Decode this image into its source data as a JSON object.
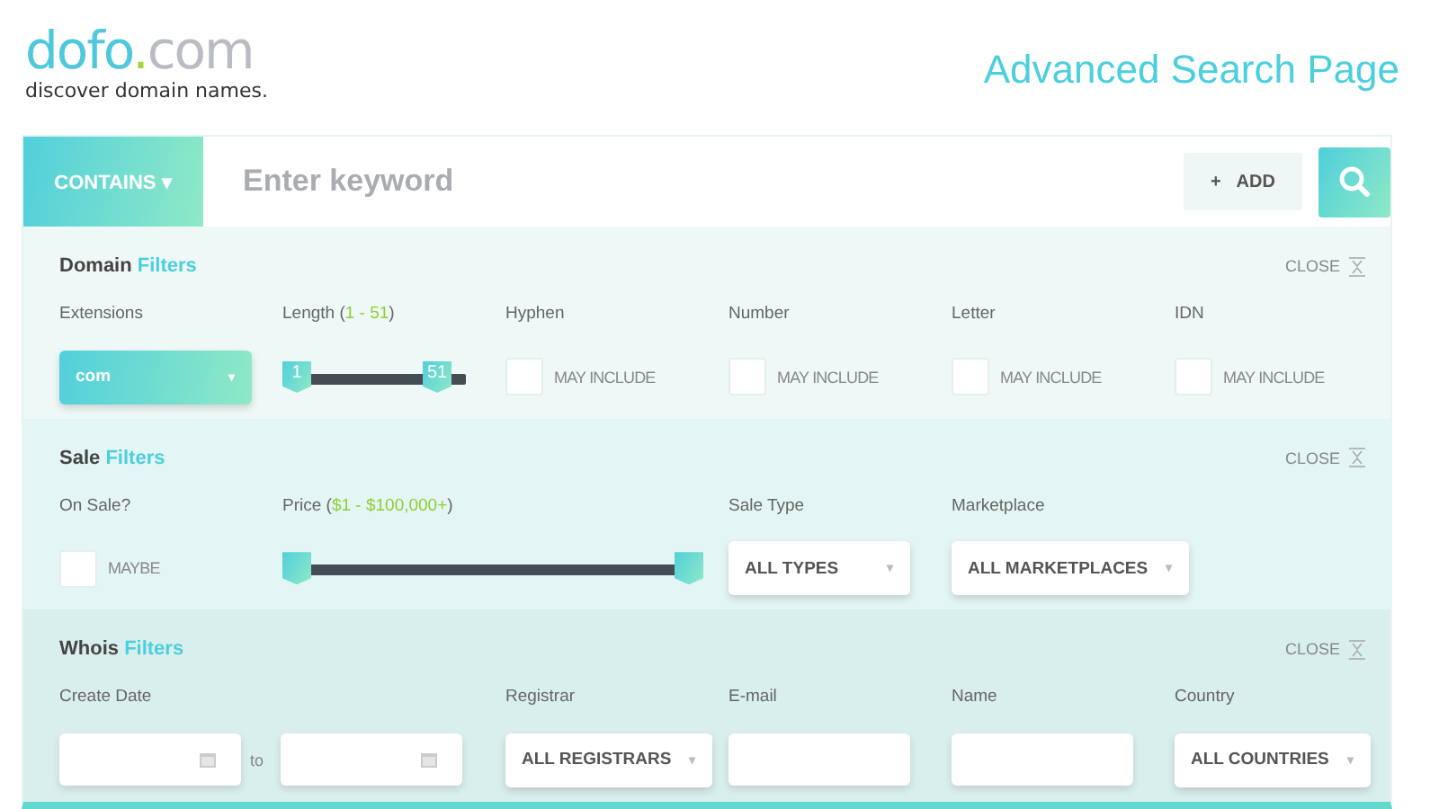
{
  "logo": {
    "name": "dofo",
    "dot": ".",
    "tld": "com",
    "tagline": "discover domain names."
  },
  "page_title": "Advanced Search Page",
  "search": {
    "mode": "CONTAINS",
    "caret": "▾",
    "placeholder": "Enter keyword",
    "add_sign": "+",
    "add_label": "ADD"
  },
  "sections": [
    {
      "title": "Domain",
      "accent": "Filters",
      "close": "CLOSE",
      "fields": [
        {
          "kind": "select",
          "label": "Extensions",
          "value": "com",
          "caret": "▾",
          "highlight": true
        },
        {
          "kind": "range",
          "label": "Length (",
          "label_value": "1 - 51",
          "label_end": ")",
          "handles": [
            {
              "text": "1",
              "level": 0
            },
            {
              "text": "51",
              "level": 0.83
            }
          ]
        },
        {
          "kind": "checkbox",
          "label": "Hyphen",
          "text": "MAY INCLUDE",
          "checked": false
        },
        {
          "kind": "checkbox",
          "label": "Number",
          "text": "MAY INCLUDE",
          "checked": false
        },
        {
          "kind": "checkbox",
          "label": "Letter",
          "text": "MAY INCLUDE",
          "checked": false
        },
        {
          "kind": "checkbox",
          "label": "IDN",
          "text": "MAY INCLUDE",
          "checked": false
        }
      ]
    },
    {
      "title": "Sale",
      "accent": "Filters",
      "close": "CLOSE",
      "fields": [
        {
          "kind": "checkbox",
          "label": "On Sale?",
          "text": "MAYBE",
          "checked": false
        },
        {
          "kind": "wide_range",
          "label": "Price (",
          "label_value": "$1 - $100,000+",
          "label_end": ")",
          "handles": [
            {
              "level": 0
            },
            {
              "level": 1
            }
          ]
        },
        {
          "kind": "select",
          "label": "Sale Type",
          "value": "ALL TYPES",
          "caret": "▾",
          "highlight": false
        },
        {
          "kind": "select",
          "label": "Marketplace",
          "value": "ALL MARKETPLACES",
          "caret": "▾",
          "highlight": false
        }
      ]
    },
    {
      "title": "Whois",
      "accent": "Filters",
      "close": "CLOSE",
      "fields": [
        {
          "kind": "date_range",
          "label": "Create Date",
          "between": "to"
        },
        {
          "kind": "select",
          "label": "Registrar",
          "value": "ALL REGISTRARS",
          "caret": "▾",
          "highlight": false
        },
        {
          "kind": "text_input",
          "label": "E-mail"
        },
        {
          "kind": "text_input",
          "label": "Name"
        },
        {
          "kind": "select",
          "label": "Country",
          "value": "ALL COUNTRIES",
          "caret": "▾",
          "highlight": false
        }
      ]
    }
  ]
}
